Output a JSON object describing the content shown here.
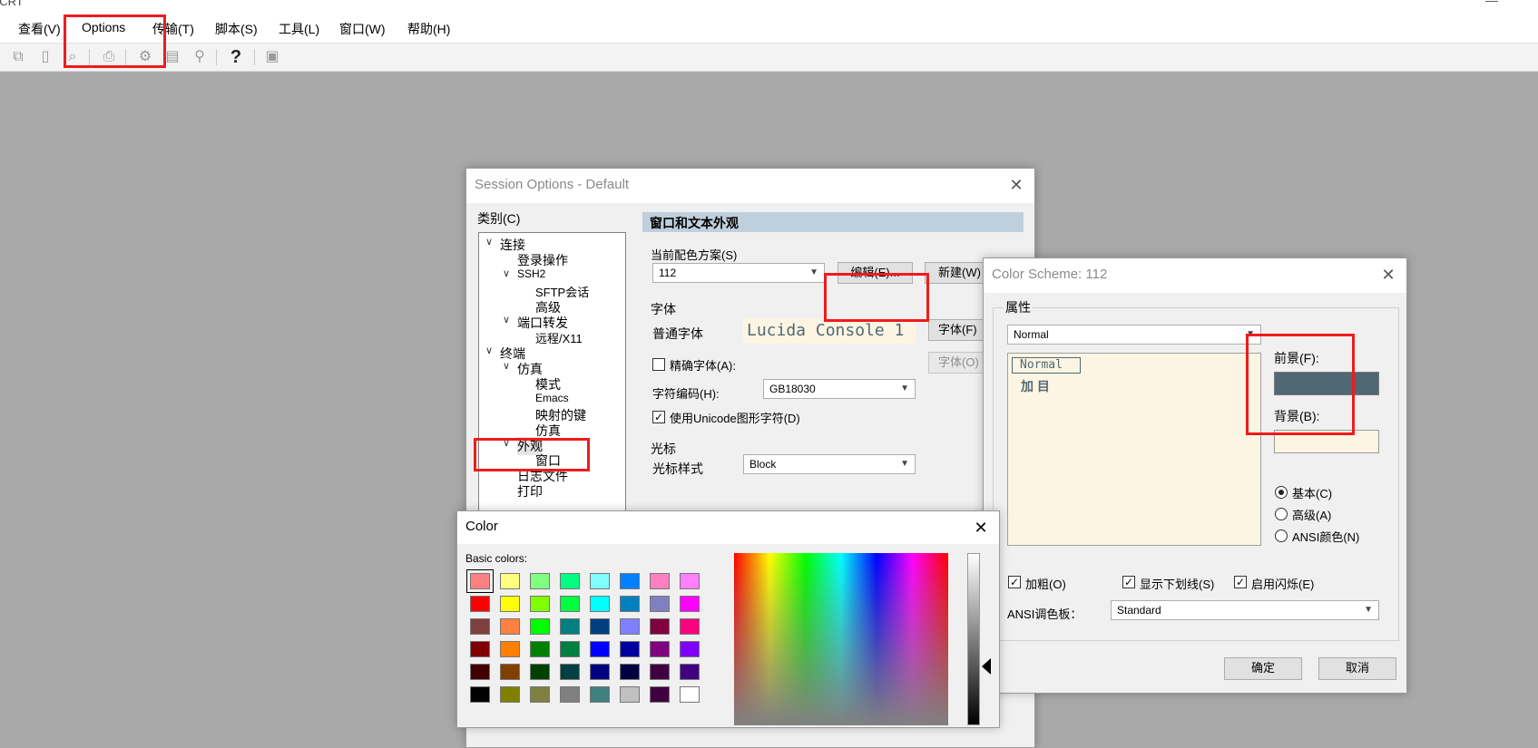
{
  "app": {
    "title_fragment": "eCRT",
    "menu": [
      "查看(V)",
      "Options",
      "传输(T)",
      "脚本(S)",
      "工具(L)",
      "窗口(W)",
      "帮助(H)"
    ],
    "toolbar_icons": [
      "copy-icon",
      "paste-icon",
      "find-icon",
      "print-icon",
      "settings-icon",
      "keymap-icon",
      "sftp-icon",
      "help-icon",
      "screen-icon"
    ]
  },
  "session_options": {
    "title": "Session Options - Default",
    "category_label": "类别(C)",
    "tree": [
      {
        "label": "连接",
        "level": 0,
        "expanded": true
      },
      {
        "label": "登录操作",
        "level": 1
      },
      {
        "label": "SSH2",
        "level": 1,
        "expanded": true
      },
      {
        "label": "SFTP会话",
        "level": 2
      },
      {
        "label": "高级",
        "level": 2
      },
      {
        "label": "端口转发",
        "level": 1,
        "expanded": true
      },
      {
        "label": "远程/X11",
        "level": 2
      },
      {
        "label": "终端",
        "level": 0,
        "expanded": true
      },
      {
        "label": "仿真",
        "level": 1,
        "expanded": true
      },
      {
        "label": "模式",
        "level": 2
      },
      {
        "label": "Emacs",
        "level": 2
      },
      {
        "label": "映射的键",
        "level": 2
      },
      {
        "label": "仿真",
        "level": 2
      },
      {
        "label": "外观",
        "level": 1,
        "expanded": true
      },
      {
        "label": "窗口",
        "level": 2
      },
      {
        "label": "日志文件",
        "level": 1
      },
      {
        "label": "打印",
        "level": 1
      }
    ],
    "panel_header": "窗口和文本外观",
    "scheme_label": "当前配色方案(S)",
    "scheme_value": "112",
    "edit_button": "编辑(E)...",
    "new_button": "新建(W)",
    "font_group": "字体",
    "normal_font_label": "普通字体",
    "font_preview": "Lucida Console 1",
    "font_button": "字体(F)",
    "precise_font_label": "精确字体(A):",
    "font_button2": "字体(O)",
    "encoding_label": "字符编码(H):",
    "encoding_value": "GB18030",
    "unicode_label": "使用Unicode图形字符(D)",
    "cursor_group": "光标",
    "cursor_style_label": "光标样式",
    "cursor_style_value": "Block"
  },
  "color_scheme": {
    "title": "Color Scheme: 112",
    "props_label": "属性",
    "attr_value": "Normal",
    "list_items": [
      "Normal",
      "加 目"
    ],
    "fg_label": "前景(F):",
    "bg_label": "背景(B):",
    "fg_color": "#4f6873",
    "bg_color": "#fdf5e3",
    "radio_basic": "基本(C)",
    "radio_adv": "高级(A)",
    "radio_ansi": "ANSI颜色(N)",
    "bold_label": "加粗(O)",
    "underline_label": "显示下划线(S)",
    "blink_label": "启用闪烁(E)",
    "ansi_palette_label": "ANSI调色板：",
    "ansi_palette_value": "Standard",
    "ok": "确定",
    "cancel": "取消"
  },
  "color_dialog": {
    "title": "Color",
    "basic_colors_label": "Basic colors:",
    "basic_colors": [
      "#ff8080",
      "#ffff80",
      "#80ff80",
      "#00ff80",
      "#80ffff",
      "#0080ff",
      "#ff80c0",
      "#ff80ff",
      "#ff0000",
      "#ffff00",
      "#80ff00",
      "#00ff40",
      "#00ffff",
      "#0080c0",
      "#8080c0",
      "#ff00ff",
      "#804040",
      "#ff8040",
      "#00ff00",
      "#008080",
      "#004080",
      "#8080ff",
      "#800040",
      "#ff0080",
      "#800000",
      "#ff8000",
      "#008000",
      "#008040",
      "#0000ff",
      "#0000a0",
      "#800080",
      "#8000ff",
      "#400000",
      "#804000",
      "#004000",
      "#004040",
      "#000080",
      "#000040",
      "#400040",
      "#400080",
      "#000000",
      "#808000",
      "#808040",
      "#808080",
      "#408080",
      "#c0c0c0",
      "#400040",
      "#ffffff"
    ]
  }
}
